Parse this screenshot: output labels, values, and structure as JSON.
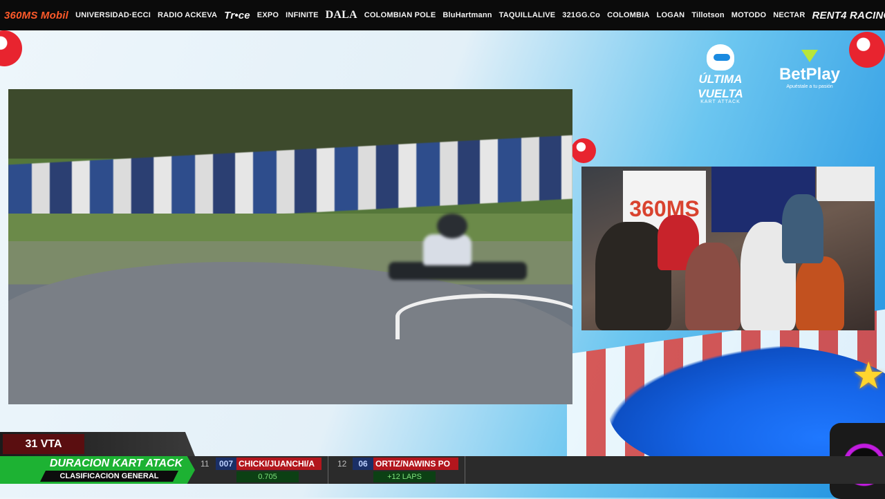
{
  "sponsors": [
    "360MS Mobil",
    "UNIVERSIDAD·ECCI",
    "RADIO ACKEVA",
    "Tr•ce",
    "EXPO",
    "INFINITE",
    "DALA",
    "COLOMBIAN POLE",
    "BluHartmann",
    "TAQUILLALIVE",
    "321GG.Co",
    "COLOMBIA",
    "LOGAN",
    "Tillotson",
    "MOTODO",
    "NECTAR",
    "RENT4 RACING"
  ],
  "logos": {
    "ultima_vuelta": {
      "line1": "ÚLTIMA",
      "line2": "VUELTA",
      "line3": "KART ATTACK"
    },
    "betplay": {
      "name": "BetPlay",
      "tagline": "Apuéstale a tu pasión"
    }
  },
  "side_feed": {
    "banner_text": "360MS"
  },
  "lap_counter": {
    "label": "31 VTA"
  },
  "race": {
    "title": "DURACION KART ATACK",
    "subtitle": "CLASIFICACION GENERAL"
  },
  "standings": [
    {
      "position": "11",
      "number": "007",
      "team": "CHICKI/JUANCHI/A",
      "gap": "0.705"
    },
    {
      "position": "12",
      "number": "06",
      "team": "ORTIZ/NAWINS PO",
      "gap": "+12 LAPS"
    }
  ],
  "colors": {
    "accent_green": "#1db233",
    "team_red": "#b3161d",
    "lap_maroon": "#5a0e10"
  }
}
